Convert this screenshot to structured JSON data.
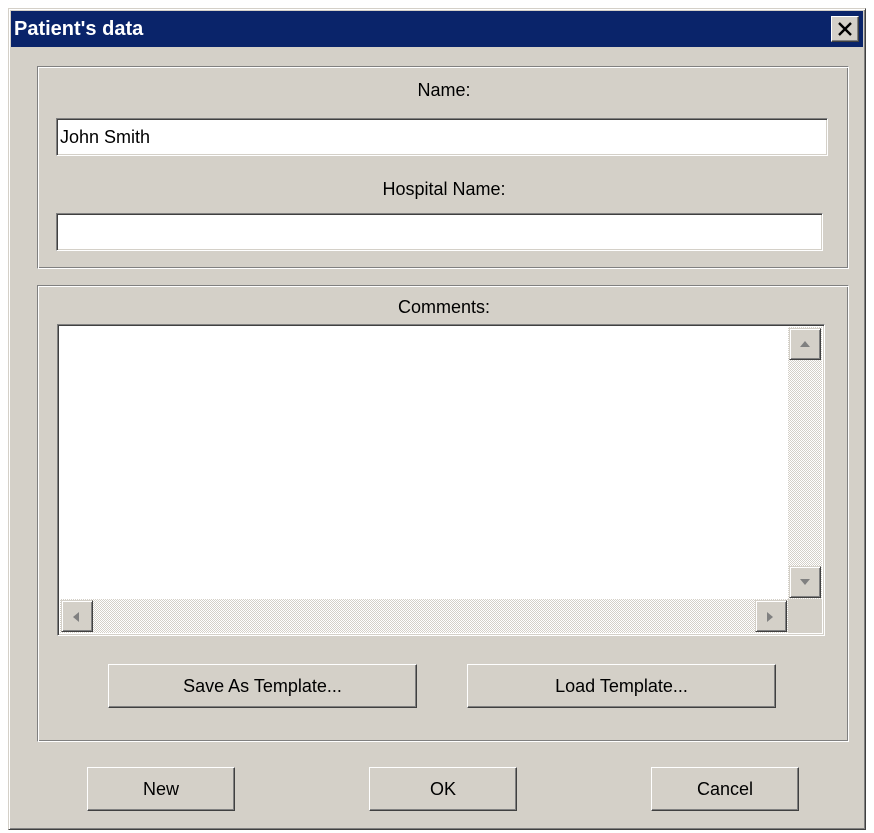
{
  "window": {
    "title": "Patient's data",
    "close_icon": "close-x-icon"
  },
  "patient_group": {
    "name_label": "Name:",
    "name_value": "John Smith",
    "hospital_label": "Hospital Name:",
    "hospital_value": ""
  },
  "comments_group": {
    "comments_label": "Comments:",
    "comments_value": "",
    "save_template_label": "Save As Template...",
    "load_template_label": "Load Template..."
  },
  "footer": {
    "new_label": "New",
    "ok_label": "OK",
    "cancel_label": "Cancel"
  },
  "colors": {
    "titlebar": "#0a246a",
    "face": "#d4d0c8",
    "field": "#ffffff"
  }
}
